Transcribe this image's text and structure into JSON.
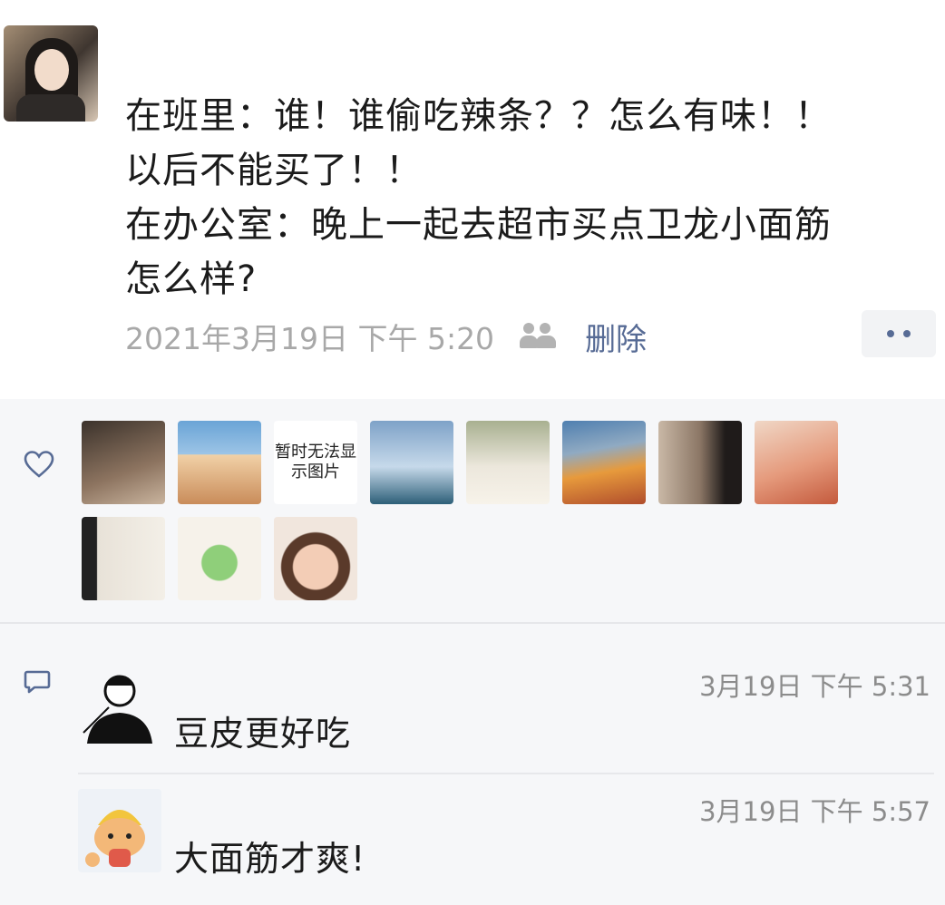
{
  "post": {
    "author": "",
    "lines": [
      "在班里：谁！谁偷吃辣条？？怎么有味！！",
      "以后不能买了！！",
      "在办公室：晚上一起去超市买点卫龙小面筋",
      "怎么样?"
    ],
    "time": "2021年3月19日 下午 5:20",
    "delete_label": "删除",
    "visibility_icon": "friends-icon",
    "more_icon": "more-dots-icon"
  },
  "likes": {
    "icon": "heart-icon",
    "count": 11,
    "unavailable_image_text": "暂时无法显示图片",
    "avatar_colors": [
      "#6b5748",
      "#d7b48c",
      "#ffffff",
      "#8fb0cf",
      "#c9c4b1",
      "#e39a45",
      "#7a6a5d",
      "#e9b39a",
      "#d8d3ca",
      "#f4eee6",
      "#e5c5b4"
    ]
  },
  "comments": [
    {
      "icon": "comment-icon",
      "author": "",
      "time": "3月19日 下午 5:31",
      "text": "豆皮更好吃"
    },
    {
      "author": "",
      "time": "3月19日 下午 5:57",
      "text": "大面筋才爽!"
    }
  ],
  "colors": {
    "link": "#576b95",
    "timestamp": "#a8a8a8",
    "background": "#f6f7f9"
  }
}
